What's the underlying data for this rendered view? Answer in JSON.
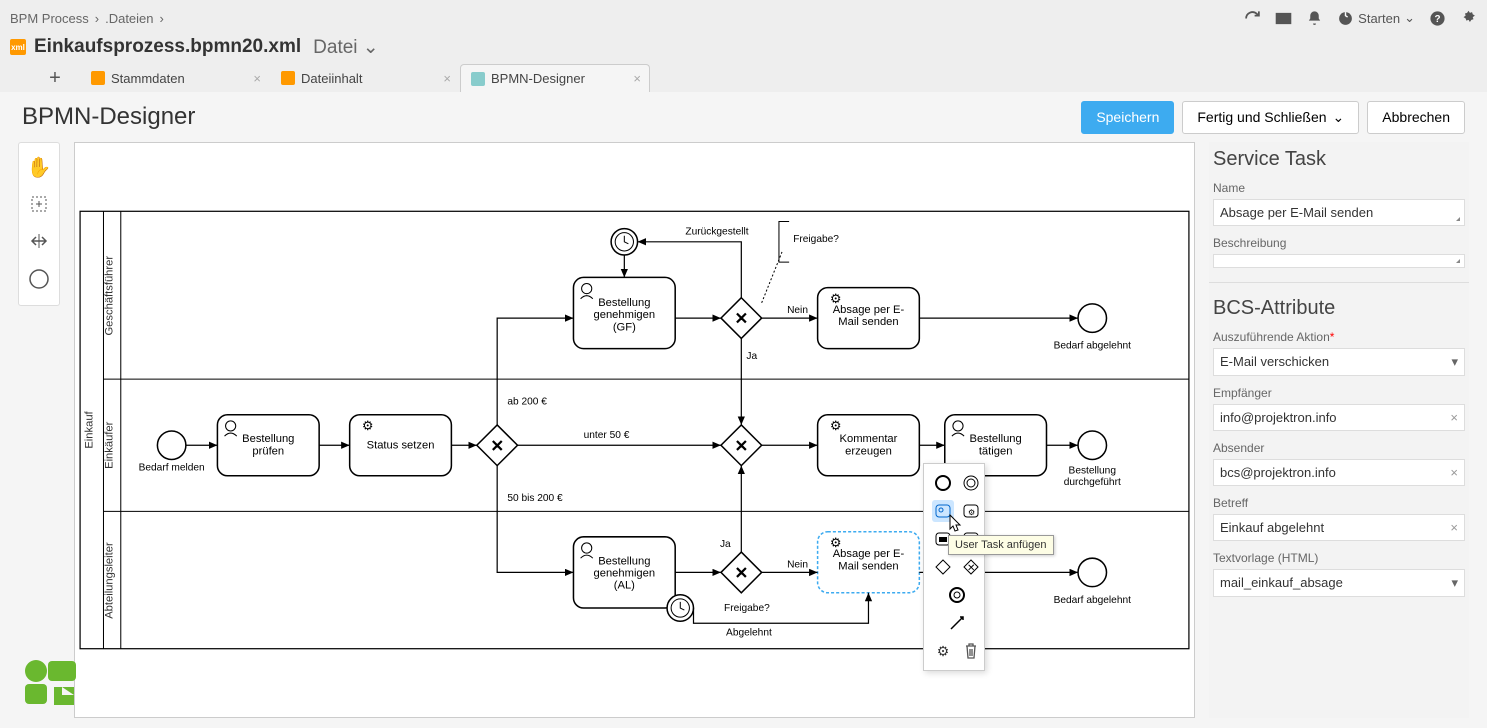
{
  "breadcrumb": [
    "BPM Process",
    ".Dateien"
  ],
  "file": {
    "name": "Einkaufsprozess.bpmn20.xml",
    "type": "Datei"
  },
  "topMenu": {
    "starten": "Starten"
  },
  "tabs": [
    {
      "label": "Stammdaten",
      "active": false,
      "icon": "xml"
    },
    {
      "label": "Dateiinhalt",
      "active": false,
      "icon": "xml"
    },
    {
      "label": "BPMN-Designer",
      "active": true,
      "icon": "bpmn"
    }
  ],
  "pageTitle": "BPMN-Designer",
  "buttons": {
    "save": "Speichern",
    "finishClose": "Fertig und Schließen",
    "cancel": "Abbrechen"
  },
  "lanes": [
    "Geschäftsführer",
    "Einkäufer",
    "Abteilungsleiter"
  ],
  "poolLabel": "Einkauf",
  "nodes": {
    "startEvent": "Bedarf melden",
    "checkOrder": "Bestellung prüfen",
    "setStatus": "Status setzen",
    "approveGF": "Bestellung genehmigen (GF)",
    "approveAL": "Bestellung genehmigen (AL)",
    "declineMail1": "Absage per E-Mail senden",
    "declineMail2": "Absage per E-Mail senden",
    "comment": "Kommentar erzeugen",
    "doOrder": "Bestellung tätigen",
    "end1": "Bedarf abgelehnt",
    "end2": "Bestellung durchgeführt",
    "end3": "Bedarf abgelehnt"
  },
  "edgeLabels": {
    "ab200": "ab 200 €",
    "unter50": "unter 50 €",
    "bis200": "50 bis 200 €",
    "zurueck": "Zurückgestellt",
    "freigabe": "Freigabe?",
    "ja": "Ja",
    "nein": "Nein",
    "abgelehnt": "Abgelehnt",
    "freigabe2": "Freigabe?"
  },
  "contextTooltip": "User Task anfügen",
  "props": {
    "sectionTask": "Service Task",
    "labelName": "Name",
    "name": "Absage per E-Mail senden",
    "labelDesc": "Beschreibung",
    "sectionBCS": "BCS-Attribute",
    "labelAction": "Auszuführende Aktion",
    "action": "E-Mail verschicken",
    "labelTo": "Empfänger",
    "to": "info@projektron.info",
    "labelFrom": "Absender",
    "from": "bcs@projektron.info",
    "labelSubject": "Betreff",
    "subject": "Einkauf abgelehnt",
    "labelTemplate": "Textvorlage (HTML)",
    "template": "mail_einkauf_absage"
  }
}
